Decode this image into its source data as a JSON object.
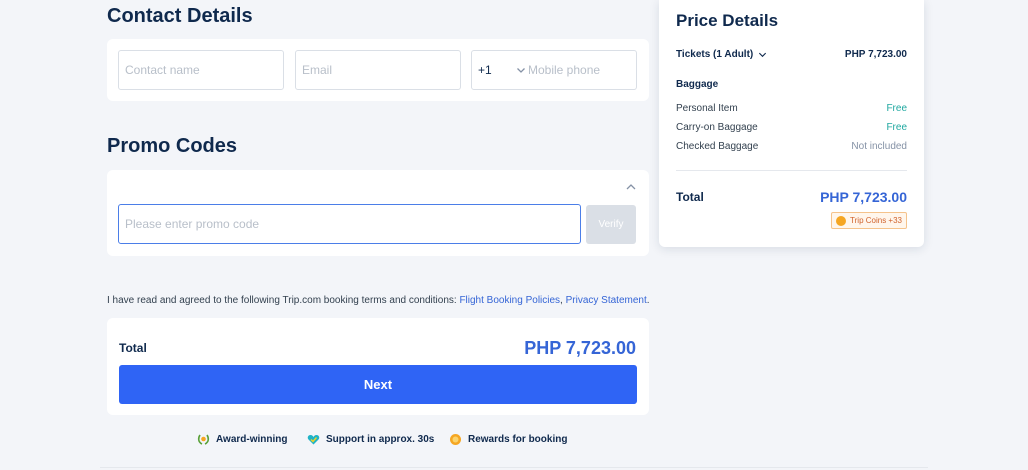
{
  "contact": {
    "title": "Contact Details",
    "name_placeholder": "Contact name",
    "email_placeholder": "Email",
    "country_code": "+1",
    "phone_placeholder": "Mobile phone"
  },
  "promo": {
    "title": "Promo Codes",
    "placeholder": "Please enter promo code",
    "verify_label": "Verify"
  },
  "terms": {
    "text": "I have read and agreed to the following Trip.com booking terms and conditions: ",
    "link1": "Flight Booking Policies",
    "separator": ", ",
    "link2": "Privacy Statement",
    "end": "."
  },
  "summary": {
    "total_label": "Total",
    "total_amount": "PHP 7,723.00",
    "next_label": "Next"
  },
  "perks": [
    {
      "label": "Award-winning",
      "icon": "laurel-icon"
    },
    {
      "label": "Support in approx. 30s",
      "icon": "heart-check-icon"
    },
    {
      "label": "Rewards for booking",
      "icon": "coin-icon"
    }
  ],
  "price_details": {
    "title": "Price Details",
    "tickets_label": "Tickets (1 Adult)",
    "tickets_amount": "PHP 7,723.00",
    "baggage_header": "Baggage",
    "items": [
      {
        "label": "Personal Item",
        "value": "Free"
      },
      {
        "label": "Carry-on Baggage",
        "value": "Free"
      },
      {
        "label": "Checked Baggage",
        "value": "Not included"
      }
    ],
    "total_label": "Total",
    "total_amount": "PHP 7,723.00",
    "coins_label": "Trip Coins +33"
  },
  "colors": {
    "primary": "#2f64f5",
    "accent_text": "#3565d6",
    "free": "#1fa8a0",
    "page_bg": "#f3f5f9"
  }
}
